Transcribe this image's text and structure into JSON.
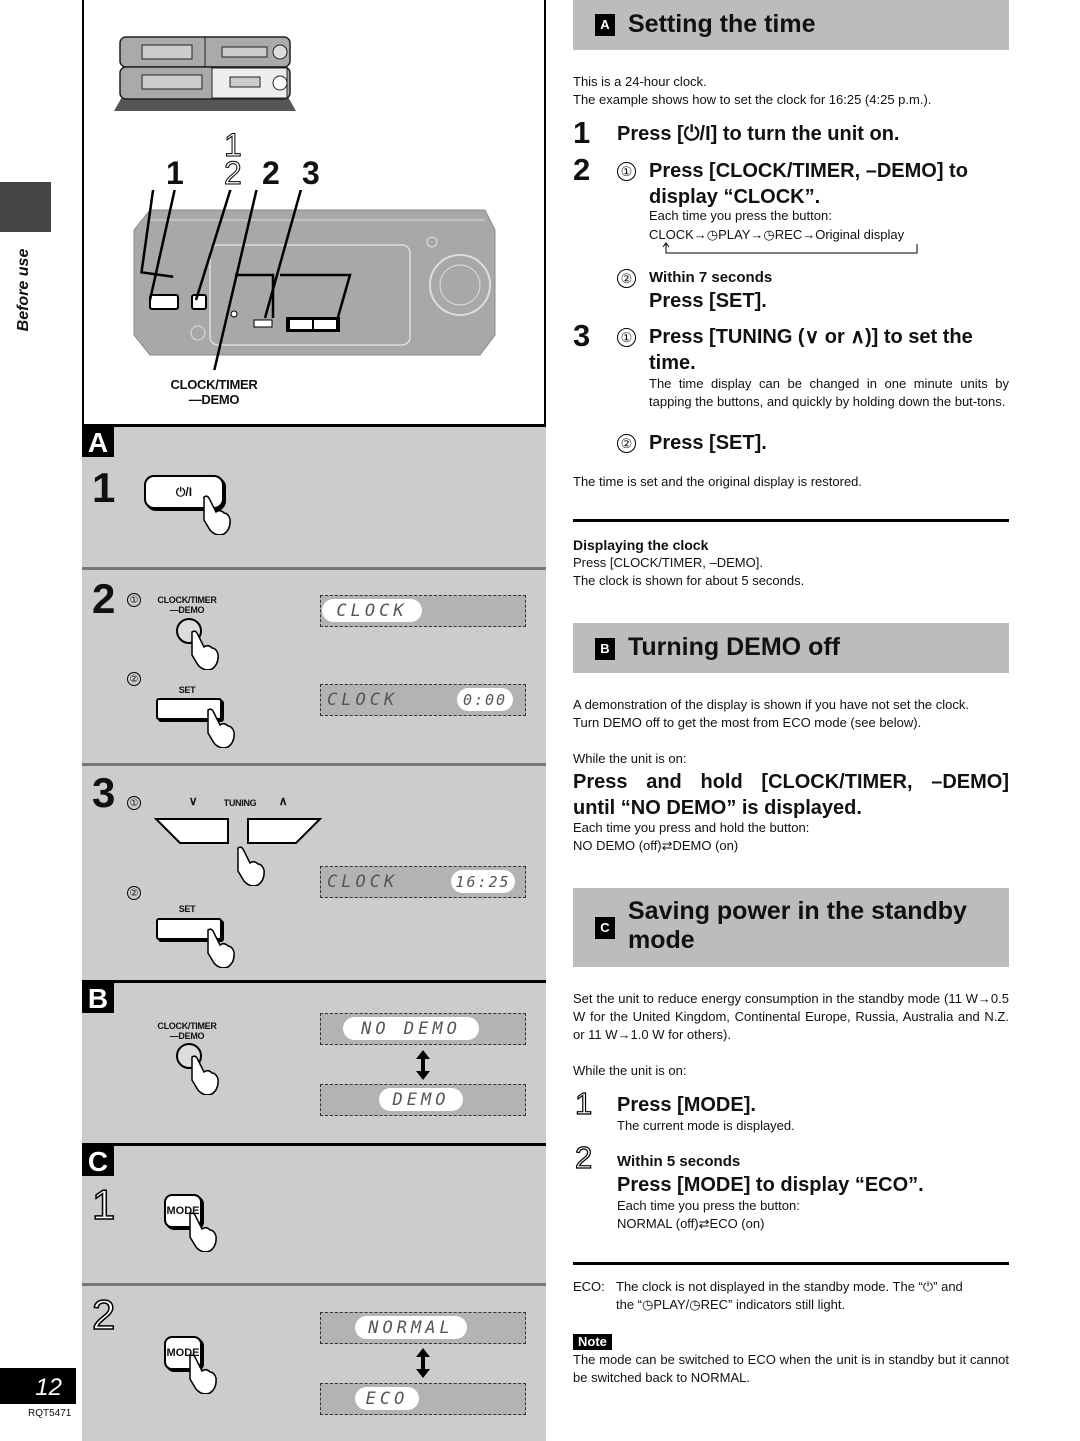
{
  "side": {
    "section_label": "Before use",
    "page_number": "12",
    "doc_code": "RQT5471"
  },
  "overview": {
    "callouts": [
      "1",
      "1",
      "2",
      "2",
      "3"
    ],
    "clock_timer_label_line1": "CLOCK/TIMER",
    "clock_timer_label_line2": "—DEMO"
  },
  "panels": {
    "A": {
      "badge": "A",
      "step1": {
        "num": "1",
        "button_label": "⏻/I"
      },
      "step2": {
        "num": "2",
        "sub1": "①",
        "button_label_line1": "CLOCK/TIMER",
        "button_label_line2": "—DEMO",
        "display1": "CLOCK",
        "sub2": "②",
        "set_label": "SET",
        "display2_left": "CLOCK",
        "display2_right": "0:00"
      },
      "step3": {
        "num": "3",
        "sub1": "①",
        "tuning_label": "TUNING",
        "down_glyph": "∨",
        "up_glyph": "∧",
        "display_left": "CLOCK",
        "display_right": "16:25",
        "sub2": "②",
        "set_label": "SET"
      }
    },
    "B": {
      "badge": "B",
      "button_label_line1": "CLOCK/TIMER",
      "button_label_line2": "—DEMO",
      "display1": "NO  DEMO",
      "display2": "DEMO"
    },
    "C": {
      "badge": "C",
      "step1": {
        "num": "1",
        "button_label": "MODE"
      },
      "step2": {
        "num": "2",
        "button_label": "MODE",
        "display1": "NORMAL",
        "display2": "ECO"
      }
    }
  },
  "section_a": {
    "badge": "A",
    "title": "Setting the time",
    "intro1": "This is a 24-hour clock.",
    "intro2": "The example shows how to set the clock for 16:25 (4:25 p.m.).",
    "step1_num": "1",
    "step1_text": "Press [⏻/I] to turn the unit on.",
    "step2_num": "2",
    "step2_sub1": "①",
    "step2_text_line1": "Press [CLOCK/TIMER, –DEMO] to",
    "step2_text_line2": "display “CLOCK”.",
    "step2_note1": "Each time you press the button:",
    "step2_cycle": "CLOCK→◷PLAY→◷REC→Original display",
    "step2_sub2": "②",
    "step2_within": "Within 7 seconds",
    "step2_press_set": "Press [SET].",
    "step3_num": "3",
    "step3_sub1": "①",
    "step3_text_line1": "Press [TUNING (∨ or ∧)] to set the",
    "step3_text_line2": "time.",
    "step3_note": "The time display can be changed in one minute units by tapping the buttons, and quickly by holding down the but-tons.",
    "step3_sub2": "②",
    "step3_press_set": "Press [SET].",
    "outro": "The time is set and the original display is restored.",
    "displaying_title": "Displaying the clock",
    "displaying_line1": "Press [CLOCK/TIMER, –DEMO].",
    "displaying_line2": "The clock is shown for about 5 seconds."
  },
  "section_b": {
    "badge": "B",
    "title": "Turning DEMO off",
    "intro1": "A demonstration of the display is shown if you have not set the clock.",
    "intro2": "Turn DEMO off to get the most from ECO mode (see below).",
    "while_on": "While the unit is on:",
    "instr_line1": "Press and hold [CLOCK/TIMER, –DEMO]",
    "instr_line2": "until “NO DEMO” is displayed.",
    "note1": "Each time you press and hold the button:",
    "note2": "NO DEMO (off)⇄DEMO (on)"
  },
  "section_c": {
    "badge": "C",
    "title_line1": "Saving power in the standby",
    "title_line2": "mode",
    "intro": "Set the unit to reduce energy consumption in the standby mode (11 W→0.5 W for the United Kingdom, Continental Europe, Russia, Australia and N.Z. or 11 W→1.0 W for others).",
    "while_on": "While the unit is on:",
    "step1_num": "1",
    "step1_text": "Press [MODE].",
    "step1_note": "The current mode is displayed.",
    "step2_num": "2",
    "step2_within": "Within 5 seconds",
    "step2_text": "Press [MODE] to display “ECO”.",
    "step2_note1": "Each time you press the button:",
    "step2_note2": "NORMAL (off)⇄ECO (on)",
    "eco_label": "ECO:",
    "eco_text_line1": "The clock is not displayed in the standby mode. The “⏻” and",
    "eco_text_line2": "the “◷PLAY/◷REC” indicators still light.",
    "note_badge": "Note",
    "note_text": "The mode can be switched to ECO when the unit is in standby but it cannot be switched back to NORMAL."
  }
}
